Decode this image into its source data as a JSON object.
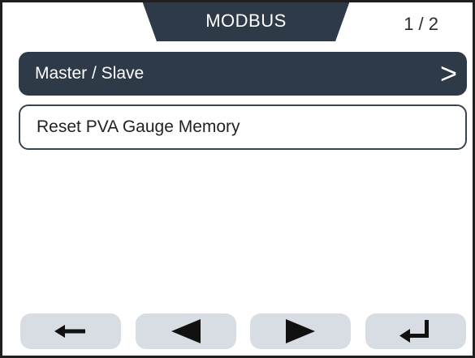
{
  "header": {
    "title": "MODBUS",
    "page_indicator": "1 / 2"
  },
  "menu": {
    "items": [
      {
        "label": "Master / Slave",
        "selected": true,
        "chevron": ">"
      },
      {
        "label": "Reset PVA Gauge Memory",
        "selected": false
      }
    ]
  },
  "nav": {
    "buttons": [
      {
        "icon": "back-arrow-icon"
      },
      {
        "icon": "previous-triangle-icon"
      },
      {
        "icon": "next-triangle-icon"
      },
      {
        "icon": "enter-return-icon"
      }
    ]
  },
  "colors": {
    "accent": "#2e3a47",
    "button_bg": "#d8dde3",
    "background": "#ffffff"
  }
}
